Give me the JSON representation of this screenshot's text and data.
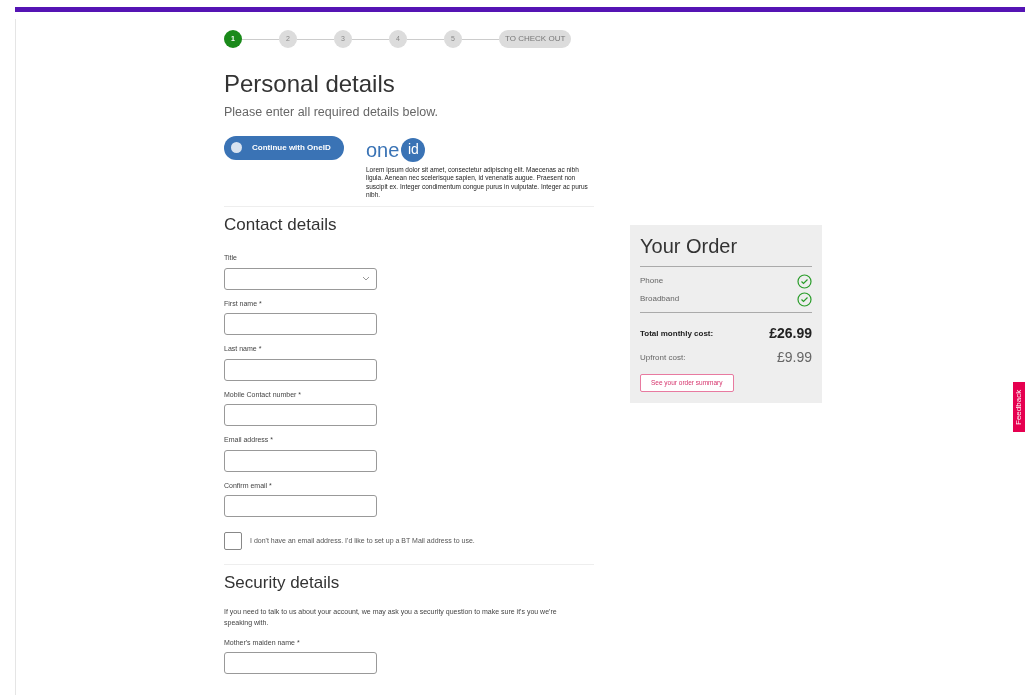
{
  "steps": [
    {
      "label": "1",
      "selected": true
    },
    {
      "label": "2",
      "selected": false
    },
    {
      "label": "3",
      "selected": false
    },
    {
      "label": "4",
      "selected": false
    },
    {
      "label": "5",
      "selected": false
    }
  ],
  "checkout_step": "TO CHECK OUT",
  "heading": "Personal details",
  "subheading": "Please enter all required details below.",
  "oneid": {
    "button": "Continue with OneID",
    "logo_text": "one",
    "logo_badge": "id",
    "description": "Lorem ipsum dolor sit amet, consectetur adipiscing elit. Maecenas ac nibh ligula. Aenean nec scelerisque sapien, id venenatis augue. Praesent non suscipit ex. Integer condimentum congue purus in vulputate. Integer ac purus nibh."
  },
  "contact": {
    "title": "Contact details",
    "fields": [
      {
        "kind": "select",
        "label": "Title"
      },
      {
        "kind": "text",
        "label": "First name *"
      },
      {
        "kind": "text",
        "label": "Last name *"
      },
      {
        "kind": "text",
        "label": "Mobile Contact number *"
      },
      {
        "kind": "text",
        "label": "Email address *"
      },
      {
        "kind": "text",
        "label": "Confirm email *"
      }
    ],
    "checkbox": {
      "label": "I don't have an email address. I'd like to set up a BT Mail address to use.",
      "checked": false
    }
  },
  "security": {
    "title": "Security details",
    "text": "If you need to talk to us about your account, we may ask you a security question to make sure it's you we're speaking with.",
    "fields": [
      {
        "kind": "text",
        "label": "Mother's maiden name *"
      }
    ]
  },
  "order": {
    "title": "Your Order",
    "items": [
      {
        "name": "Phone",
        "included": true
      },
      {
        "name": "Broadband",
        "included": true
      }
    ],
    "total_label": "Total monthly cost:",
    "total_value": "£26.99",
    "upfront_label": "Upfront cost:",
    "upfront_value": "£9.99",
    "summary_button": "See your order summary"
  },
  "feedback_tab": "Feedback"
}
